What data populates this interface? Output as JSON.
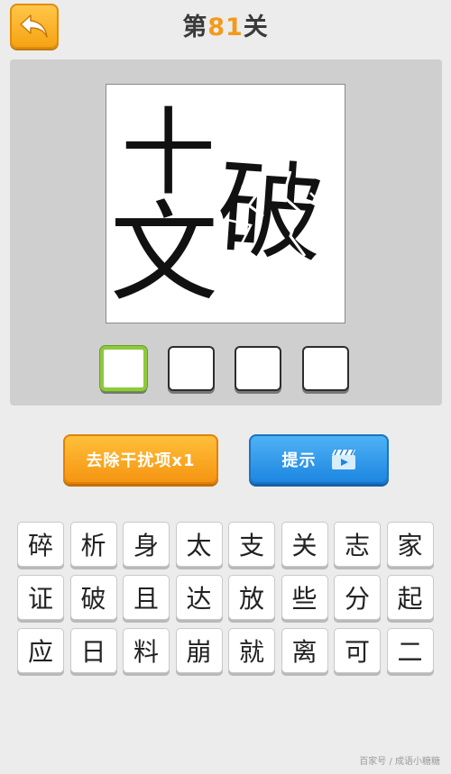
{
  "header": {
    "title_prefix": "第",
    "level_number": "81",
    "title_suffix": "关"
  },
  "puzzle": {
    "chars_left_top": "十",
    "chars_left_bottom": "文",
    "chars_right": "破"
  },
  "answer_slots": 4,
  "buttons": {
    "remove_label": "去除干扰项x1",
    "hint_label": "提示"
  },
  "candidates": [
    "碎",
    "析",
    "身",
    "太",
    "支",
    "关",
    "志",
    "家",
    "证",
    "破",
    "且",
    "达",
    "放",
    "些",
    "分",
    "起",
    "应",
    "日",
    "料",
    "崩",
    "就",
    "离",
    "可",
    "二"
  ],
  "watermark": "百家号 / 成语小糖糖",
  "colors": {
    "accent_orange": "#f39a1a",
    "hint_blue": "#1d86e0",
    "active_slot_green": "#8fc93e"
  }
}
